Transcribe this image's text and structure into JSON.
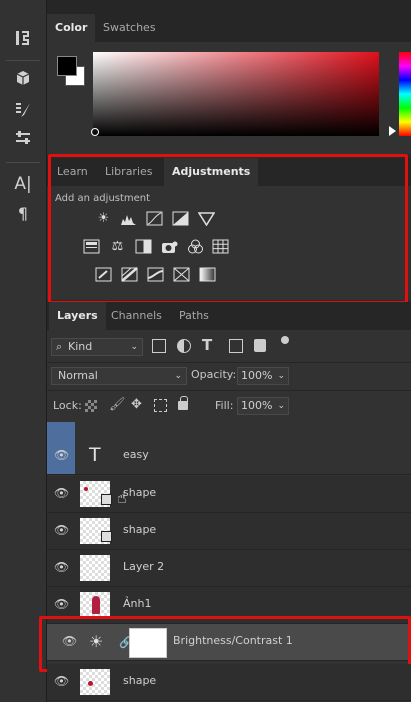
{
  "tabs_top": [
    "Color",
    "Swatches"
  ],
  "tabs_mid": [
    "Learn",
    "Libraries",
    "Adjustments"
  ],
  "adjustments": {
    "heading": "Add an adjustment"
  },
  "tabs_layers": [
    "Layers",
    "Channels",
    "Paths"
  ],
  "filter": {
    "label": "Kind"
  },
  "blend": {
    "mode": "Normal",
    "opacity_label": "Opacity:",
    "opacity_value": "100%"
  },
  "lock": {
    "label": "Lock:",
    "fill_label": "Fill:",
    "fill_value": "100%"
  },
  "layers": [
    {
      "name": "easy"
    },
    {
      "name": "shape"
    },
    {
      "name": "shape"
    },
    {
      "name": "Layer 2"
    },
    {
      "name": "Ảnh1"
    },
    {
      "name": "Brightness/Contrast 1"
    },
    {
      "name": "shape"
    }
  ],
  "tool_icons": [
    "history-brush-icon",
    "3d-cube-icon",
    "brush-settings-icon",
    "adjust-sliders-icon",
    "character-icon",
    "paragraph-icon"
  ],
  "adjustment_icons": [
    "brightness-icon",
    "levels-icon",
    "curves-icon",
    "exposure-icon",
    "vibrance-icon",
    "hue-saturation-icon",
    "color-balance-icon",
    "black-white-icon",
    "photo-filter-icon",
    "channel-mixer-icon",
    "color-lookup-icon",
    "invert-icon",
    "posterize-icon",
    "threshold-icon",
    "selective-color-icon",
    "gradient-map-icon"
  ],
  "colors": {
    "highlight": "#e01010",
    "accent": "#4e6f9e"
  }
}
